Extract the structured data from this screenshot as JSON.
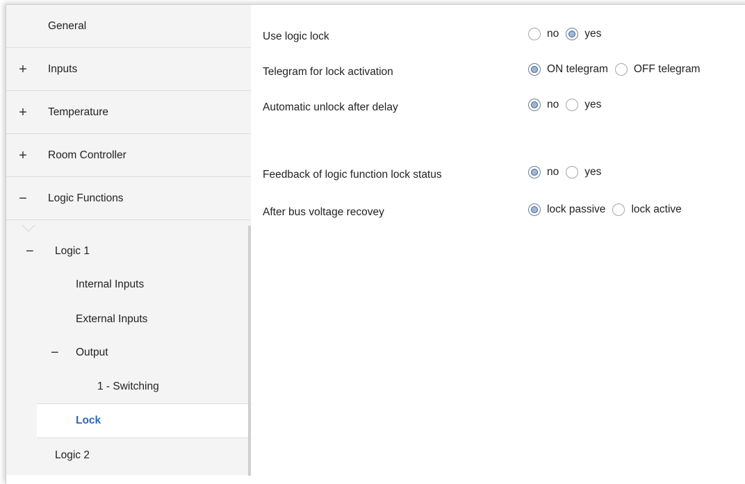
{
  "sidebar": {
    "top_items": [
      {
        "label": "General",
        "sign": ""
      },
      {
        "label": "Inputs",
        "sign": "+"
      },
      {
        "label": "Temperature",
        "sign": "+"
      },
      {
        "label": "Room Controller",
        "sign": "+"
      },
      {
        "label": "Logic Functions",
        "sign": "−"
      }
    ],
    "logic1": {
      "label": "Logic 1",
      "sign": "−"
    },
    "internal_inputs": "Internal Inputs",
    "external_inputs": "External Inputs",
    "output": {
      "label": "Output",
      "sign": "−"
    },
    "switching": "1 - Switching",
    "lock": "Lock",
    "logic2": "Logic 2"
  },
  "params": [
    {
      "label": "Use logic lock",
      "options": [
        "no",
        "yes"
      ],
      "selected": 1
    },
    {
      "label": "Telegram for lock activation",
      "options": [
        "ON telegram",
        "OFF telegram"
      ],
      "selected": 0
    },
    {
      "label": "Automatic unlock after delay",
      "options": [
        "no",
        "yes"
      ],
      "selected": 0
    },
    {
      "label": "Feedback of logic function lock status",
      "options": [
        "no",
        "yes"
      ],
      "selected": 0
    },
    {
      "label": "After bus voltage recovey",
      "options": [
        "lock passive",
        "lock active"
      ],
      "selected": 0
    }
  ],
  "colors": {
    "active_text": "#2a6bb0",
    "radio_fill": "#9db7d6",
    "sidebar_bg": "#f4f4f4"
  }
}
